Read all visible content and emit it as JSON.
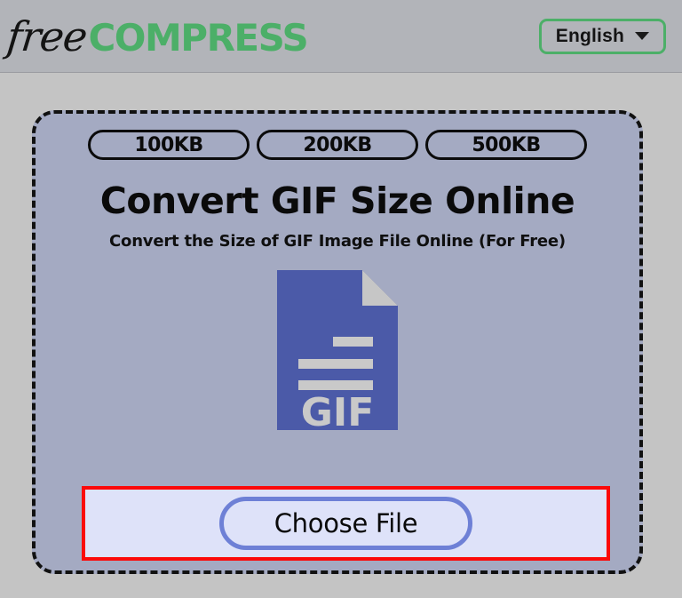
{
  "header": {
    "logo": {
      "part1": "free",
      "part2": "COMPRESS",
      "accent_color": "#4caf68"
    },
    "language_selector": {
      "label": "English",
      "icon": "chevron-down-icon",
      "border_color": "#4caf68"
    }
  },
  "main": {
    "size_presets": [
      {
        "label": "100KB"
      },
      {
        "label": "200KB"
      },
      {
        "label": "500KB"
      }
    ],
    "title": "Convert GIF Size Online",
    "subtitle": "Convert the Size of GIF Image File Online (For Free)",
    "file_icon": {
      "name": "gif-file-icon",
      "label": "GIF",
      "body_color": "#4b5aa8",
      "fold_color": "#c6c6c6",
      "line_color": "#c9c9c9"
    },
    "choose_file": {
      "label": "Choose File",
      "border_color": "#6e80d6",
      "fill_color": "#dee2f9",
      "highlight_color": "#fb0a0a"
    }
  },
  "colors": {
    "page_background": "#c4c4c4",
    "header_background": "#b2b4b9",
    "panel_background": "#a4aac2",
    "dash_border": "#111111"
  }
}
